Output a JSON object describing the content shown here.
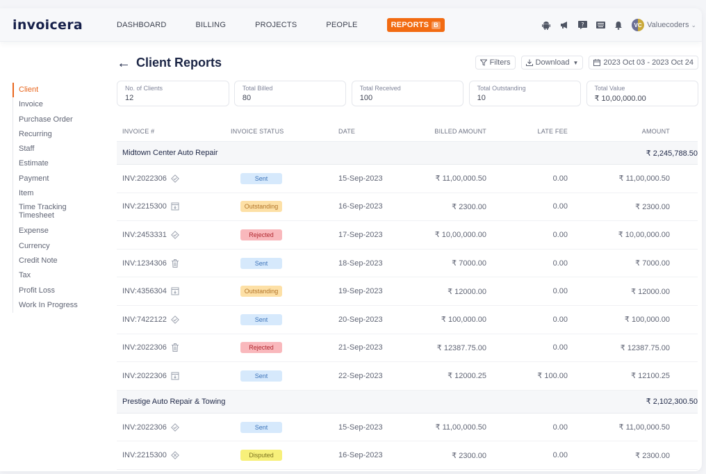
{
  "app": {
    "logo": "invoicera",
    "user_name": "Valuecoders",
    "avatar_initials": "VC"
  },
  "nav": {
    "items": [
      {
        "label": "DASHBOARD"
      },
      {
        "label": "BILLING"
      },
      {
        "label": "PROJECTS"
      },
      {
        "label": "PEOPLE"
      }
    ],
    "active": {
      "label": "REPORTS",
      "badge": "B"
    }
  },
  "top_icons": [
    "android-icon",
    "megaphone-icon",
    "help-icon",
    "keyboard-icon",
    "bell-icon"
  ],
  "sidebar": {
    "items": [
      {
        "label": "Client",
        "active": true
      },
      {
        "label": "Invoice"
      },
      {
        "label": "Purchase Order"
      },
      {
        "label": "Recurring"
      },
      {
        "label": "Staff"
      },
      {
        "label": "Estimate"
      },
      {
        "label": "Payment"
      },
      {
        "label": "Item"
      },
      {
        "label": "Time Tracking Timesheet"
      },
      {
        "label": "Expense"
      },
      {
        "label": "Currency"
      },
      {
        "label": "Credit Note"
      },
      {
        "label": "Tax"
      },
      {
        "label": "Profit Loss"
      },
      {
        "label": "Work In Progress"
      }
    ]
  },
  "header": {
    "title": "Client Reports",
    "filters_label": "Filters",
    "download_label": "Download",
    "date_range": "2023 Oct 03 - 2023 Oct 24"
  },
  "summary": [
    {
      "label": "No. of Clients",
      "value": "12"
    },
    {
      "label": "Total Billed",
      "value": "80"
    },
    {
      "label": "Total Received",
      "value": "100"
    },
    {
      "label": "Total Outstanding",
      "value": "10"
    },
    {
      "label": "Total Value",
      "value": "₹ 10,00,000.00"
    }
  ],
  "table": {
    "columns": [
      "INVOICE #",
      "INVOICE STATUS",
      "DATE",
      "BILLED AMOUNT",
      "LATE FEE",
      "AMOUNT"
    ],
    "groups": [
      {
        "client": "Midtown Center Auto Repair",
        "total": "₹ 2,245,788.50",
        "rows": [
          {
            "invoice": "INV:2022306",
            "icon": "approved",
            "status": "Sent",
            "date": "15-Sep-2023",
            "billed": "₹ 11,00,000.50",
            "late_fee": "0.00",
            "amount": "₹ 11,00,000.50"
          },
          {
            "invoice": "INV:2215300",
            "icon": "archive",
            "status": "Outstanding",
            "date": "16-Sep-2023",
            "billed": "₹ 2300.00",
            "late_fee": "0.00",
            "amount": "₹ 2300.00"
          },
          {
            "invoice": "INV:2453331",
            "icon": "approved",
            "status": "Rejected",
            "date": "17-Sep-2023",
            "billed": "₹ 10,00,000.00",
            "late_fee": "0.00",
            "amount": "₹ 10,00,000.00"
          },
          {
            "invoice": "INV:1234306",
            "icon": "trash",
            "status": "Sent",
            "date": "18-Sep-2023",
            "billed": "₹ 7000.00",
            "late_fee": "0.00",
            "amount": "₹ 7000.00"
          },
          {
            "invoice": "INV:4356304",
            "icon": "archive",
            "status": "Outstanding",
            "date": "19-Sep-2023",
            "billed": "₹ 12000.00",
            "late_fee": "0.00",
            "amount": "₹ 12000.00"
          },
          {
            "invoice": "INV:7422122",
            "icon": "approved",
            "status": "Sent",
            "date": "20-Sep-2023",
            "billed": "₹ 100,000.00",
            "late_fee": "0.00",
            "amount": "₹ 100,000.00"
          },
          {
            "invoice": "INV:2022306",
            "icon": "trash",
            "status": "Rejected",
            "date": "21-Sep-2023",
            "billed": "₹ 12387.75.00",
            "late_fee": "0.00",
            "amount": "₹ 12387.75.00"
          },
          {
            "invoice": "INV:2022306",
            "icon": "archive",
            "status": "Sent",
            "date": "22-Sep-2023",
            "billed": "₹ 12000.25",
            "late_fee": "₹ 100.00",
            "amount": "₹ 12100.25"
          }
        ]
      },
      {
        "client": "Prestige Auto Repair & Towing",
        "total": "₹ 2,102,300.50",
        "rows": [
          {
            "invoice": "INV:2022306",
            "icon": "approved",
            "status": "Sent",
            "date": "15-Sep-2023",
            "billed": "₹ 11,00,000.50",
            "late_fee": "0.00",
            "amount": "₹ 11,00,000.50"
          },
          {
            "invoice": "INV:2215300",
            "icon": "cancelled",
            "status": "Disputed",
            "date": "16-Sep-2023",
            "billed": "₹ 2300.00",
            "late_fee": "0.00",
            "amount": "₹ 2300.00"
          }
        ]
      }
    ]
  },
  "colors": {
    "accent": "#f26b12",
    "title": "#1b2545",
    "sent_bg": "#d6e9fc",
    "outstanding_bg": "#fde0a6",
    "rejected_bg": "#f9b8bc",
    "disputed_bg": "#f7f07a"
  }
}
